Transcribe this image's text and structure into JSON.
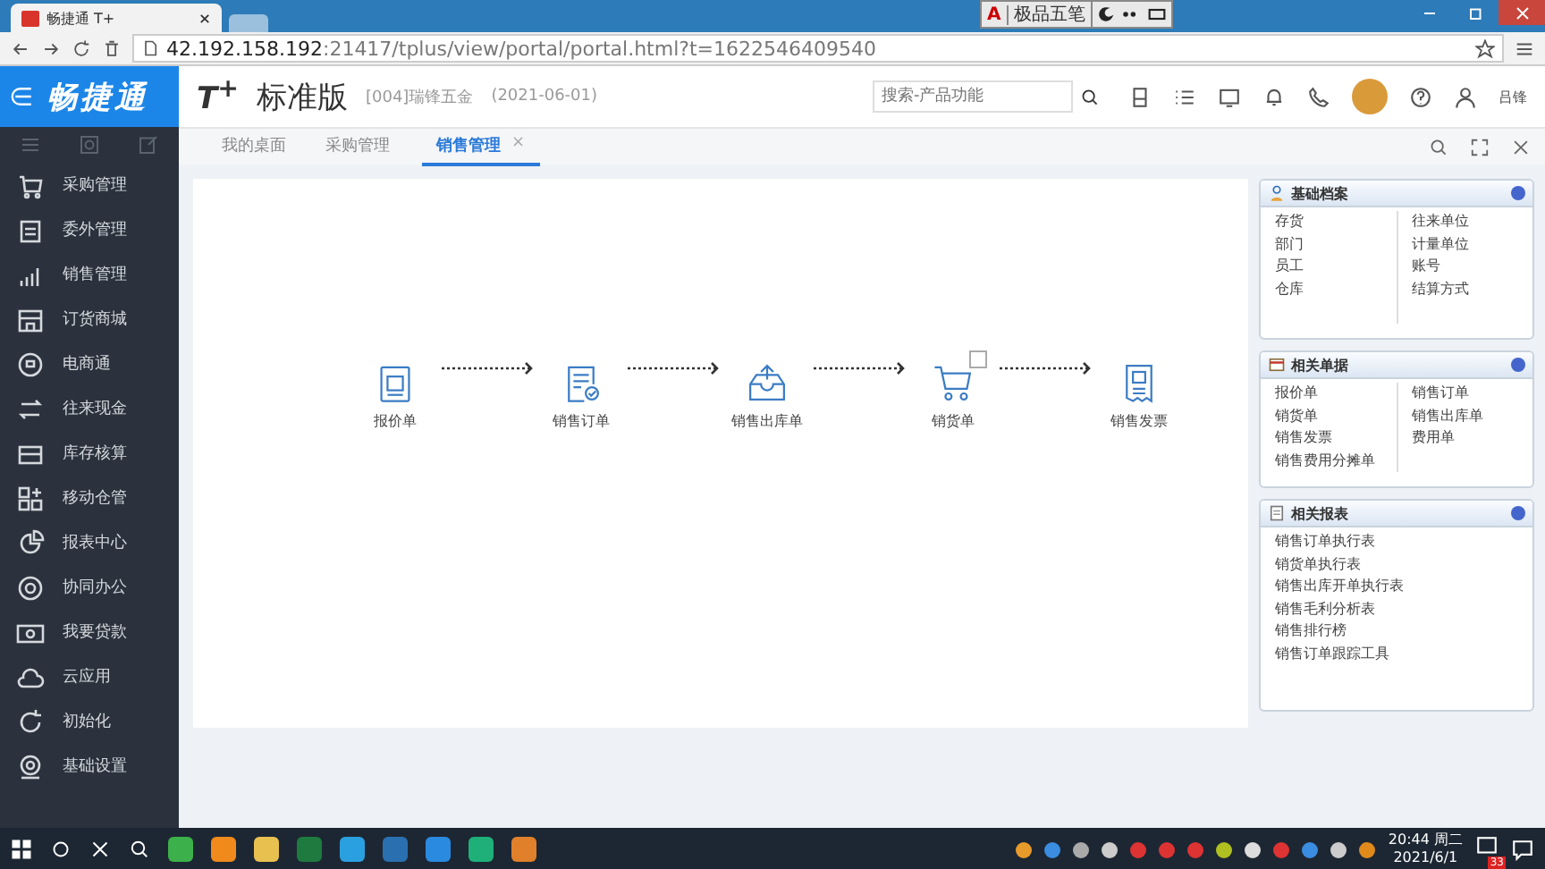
{
  "browser": {
    "tab_title": "畅捷通 T+",
    "url_host": "42.192.158.192",
    "url_rest": ":21417/tplus/view/portal/portal.html?t=1622546409540"
  },
  "ime": {
    "mode": "A",
    "name": "极品五笔"
  },
  "header": {
    "logo": "畅捷通",
    "brand": "T$^{+}$",
    "edition": "标准版",
    "account": "[004]瑞锋五金",
    "date": "(2021-06-01)",
    "search_placeholder": "搜索-产品功能",
    "user": "吕锋"
  },
  "tabs": [
    {
      "label": "我的桌面",
      "selected": false
    },
    {
      "label": "采购管理",
      "selected": false
    },
    {
      "label": "销售管理",
      "selected": true,
      "close": "×"
    }
  ],
  "sidebar": {
    "items": [
      {
        "label": "采购管理",
        "selected": false
      },
      {
        "label": "委外管理",
        "selected": false
      },
      {
        "label": "销售管理",
        "selected": false
      },
      {
        "label": "订货商城",
        "selected": false
      },
      {
        "label": "电商通",
        "selected": false
      },
      {
        "label": "往来现金",
        "selected": false
      },
      {
        "label": "库存核算",
        "selected": false
      },
      {
        "label": "移动仓管",
        "selected": false
      },
      {
        "label": "报表中心",
        "selected": false
      },
      {
        "label": "协同办公",
        "selected": false
      },
      {
        "label": "我要贷款",
        "selected": false
      },
      {
        "label": "云应用",
        "selected": false
      },
      {
        "label": "初始化",
        "selected": false
      },
      {
        "label": "基础设置",
        "selected": false
      }
    ]
  },
  "flow": [
    {
      "label": "报价单",
      "kind": "quote",
      "dropdown": false
    },
    {
      "label": "销售订单",
      "kind": "order",
      "dropdown": false
    },
    {
      "label": "销售出库单",
      "kind": "outbound",
      "dropdown": false
    },
    {
      "label": "销货单",
      "kind": "cart",
      "dropdown": true
    },
    {
      "label": "销售发票",
      "kind": "invoice",
      "dropdown": false
    }
  ],
  "panels": [
    {
      "title": "基础档案",
      "kind": "person",
      "columns": [
        [
          "存货",
          "部门",
          "员工",
          "仓库"
        ],
        [
          "往来单位",
          "计量单位",
          "账号",
          "结算方式"
        ]
      ]
    },
    {
      "title": "相关单据",
      "kind": "table",
      "columns": [
        [
          "报价单",
          "销货单",
          "销售发票",
          "销售费用分摊单"
        ],
        [
          "销售订单",
          "销售出库单",
          "费用单"
        ]
      ]
    },
    {
      "title": "相关报表",
      "kind": "report",
      "columns": [
        [
          "销售订单执行表",
          "销货单执行表",
          "销售出库开单执行表",
          "销售毛利分析表",
          "销售排行榜",
          "销售订单跟踪工具"
        ]
      ]
    }
  ],
  "taskbar": {
    "time": "20:44 周二",
    "date": "2021/6/1",
    "badge": "33"
  }
}
